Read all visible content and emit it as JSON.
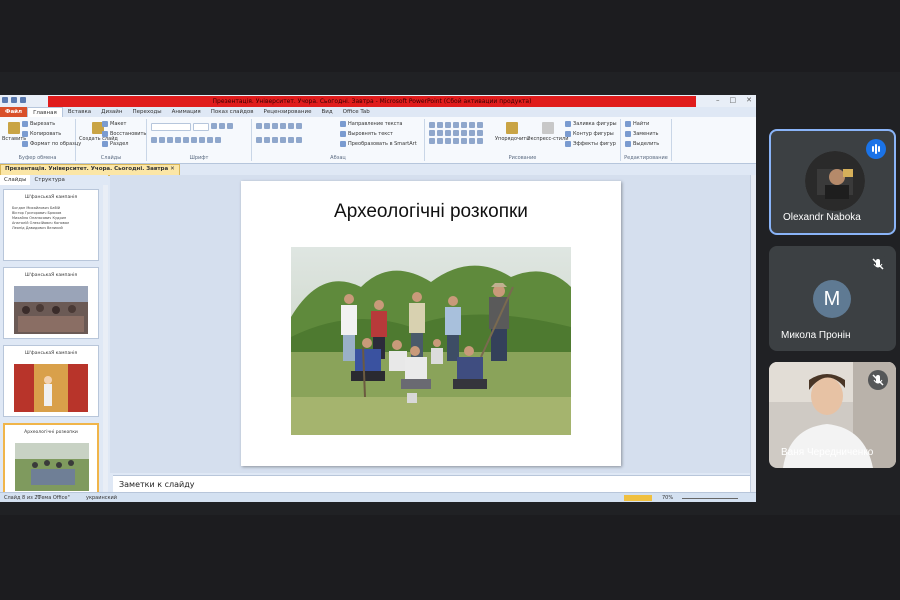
{
  "ppt": {
    "title": "Презентація. Університет. Учора. Сьогодні. Завтра - Microsoft PowerPoint (Сбой активации продукта)",
    "tabs": [
      "Файл",
      "Главная",
      "Вставка",
      "Дизайн",
      "Переходы",
      "Анимация",
      "Показ слайдов",
      "Рецензирование",
      "Вид",
      "Office Tab"
    ],
    "ribbon": {
      "clipboard": {
        "paste": "Вставить",
        "cut": "Вырезать",
        "copy": "Копировать",
        "format": "Формат по образцу",
        "label": "Буфер обмена"
      },
      "slides": {
        "new": "Создать слайд",
        "layout": "Макет",
        "reset": "Восстановить",
        "section": "Раздел",
        "label": "Слайды"
      },
      "font": {
        "label": "Шрифт"
      },
      "paragraph": {
        "dir": "Направление текста",
        "align": "Выровнять текст",
        "smartart": "Преобразовать в SmartArt",
        "label": "Абзац"
      },
      "drawing": {
        "arrange": "Упорядочить",
        "styles": "Экспресс-стили",
        "fill": "Заливка фигуры",
        "outline": "Контур фигуры",
        "effects": "Эффекты фигур",
        "label": "Рисование"
      },
      "editing": {
        "find": "Найти",
        "replace": "Заменить",
        "select": "Выделить",
        "label": "Редактирование"
      }
    },
    "doc_tab": "Презентація. Університет. Учора. Сьогодні. Завтра",
    "panel_tabs": [
      "Слайды",
      "Структура"
    ],
    "thumbs": [
      {
        "title": "Ш'фанськаЯ кампанія",
        "lines": [
          "Богдан Михайлович Бабій",
          "Віктор Григорович Брюхов",
          "Михайло Опанасович Кудрин",
          "Анатолій Олексійович Коновал",
          "Леонід Давидович Великий"
        ]
      },
      {
        "title": "Ш'фанськаЯ кампанія"
      },
      {
        "title": "Ш'фанськаЯ кампанія"
      },
      {
        "title": "Археологічні розкопки"
      }
    ],
    "slide_title": "Археологічні розкопки",
    "notes_placeholder": "Заметки к слайду",
    "status": {
      "slide": "Слайд 8 из 20",
      "theme": "\"Тема Office\"",
      "lang": "украинский",
      "zoom": "70%"
    }
  },
  "participants": [
    {
      "name": "Olexandr Naboka",
      "speaking": true
    },
    {
      "name": "Микола Пронін",
      "initial": "M",
      "muted": true
    },
    {
      "name": "Ваня Чередниченко",
      "muted": true
    }
  ],
  "colors": {
    "meet_bg": "#202124",
    "tile_bg": "#3c4043",
    "accent": "#1a73e8",
    "title_red": "#e01c1c"
  }
}
